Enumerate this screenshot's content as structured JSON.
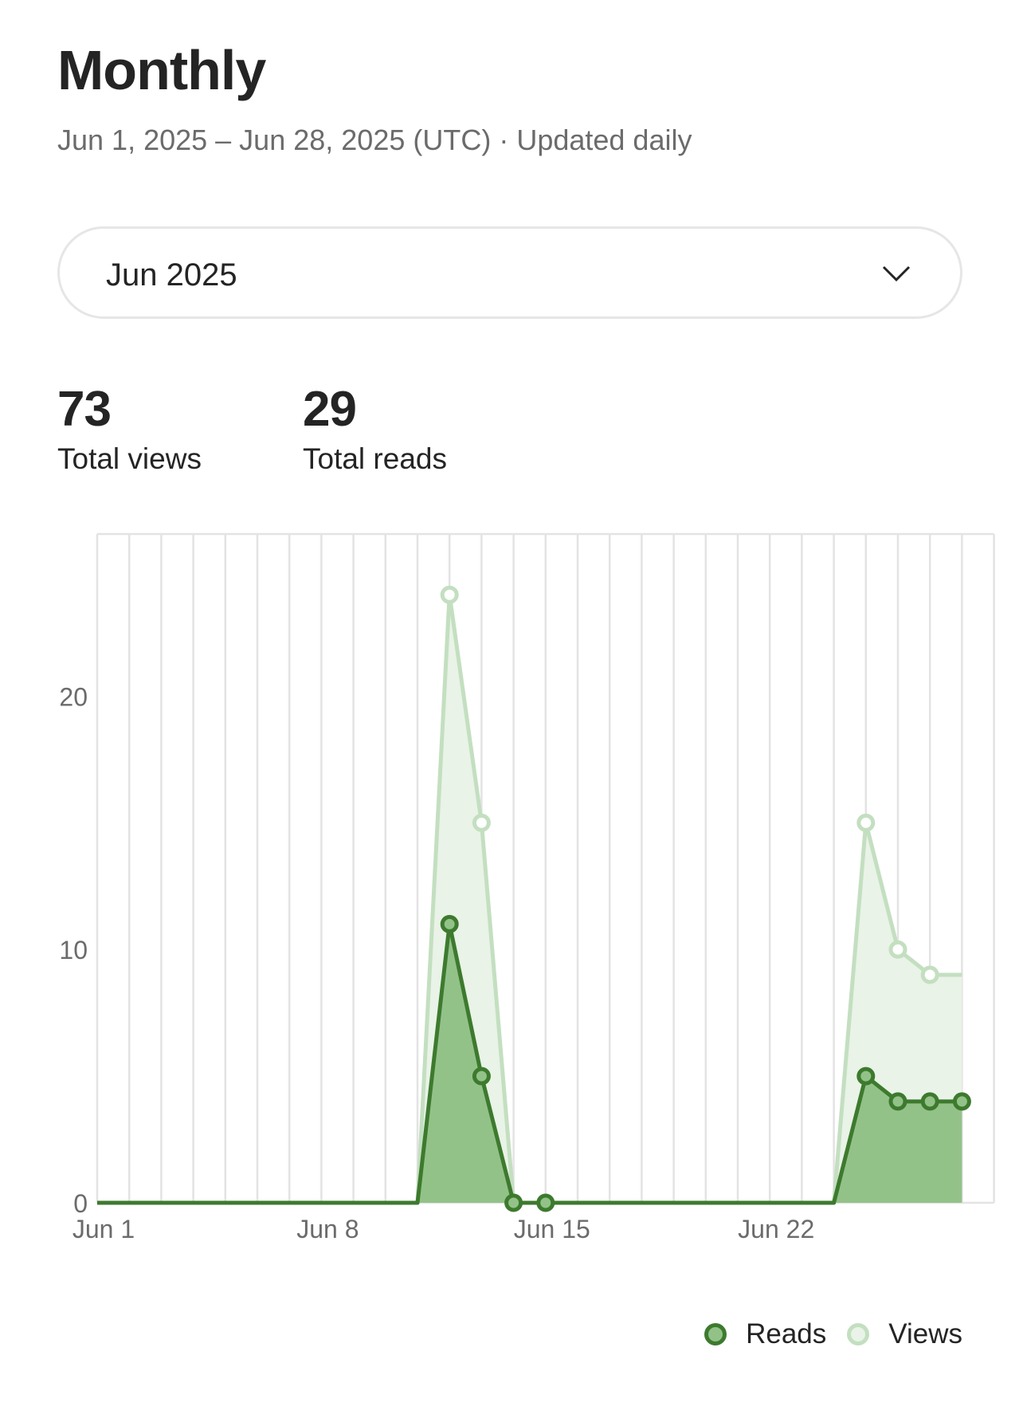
{
  "header": {
    "title": "Monthly",
    "subtitle": "Jun 1, 2025 – Jun 28, 2025 (UTC) · Updated daily"
  },
  "month_select": {
    "value": "Jun 2025",
    "icon": "chevron-down-icon"
  },
  "stats": {
    "views": {
      "value": "73",
      "label": "Total views"
    },
    "reads": {
      "value": "29",
      "label": "Total reads"
    }
  },
  "colors": {
    "reads_line": "#3d7a2e",
    "reads_fill": "#93c289",
    "views_line": "#c3dfc0",
    "views_fill": "#e9f3e7",
    "grid": "#e3e3e3",
    "tick_text": "#6b6b6b"
  },
  "chart_data": {
    "type": "area",
    "x": [
      "Jun 1",
      "Jun 2",
      "Jun 3",
      "Jun 4",
      "Jun 5",
      "Jun 6",
      "Jun 7",
      "Jun 8",
      "Jun 9",
      "Jun 10",
      "Jun 11",
      "Jun 12",
      "Jun 13",
      "Jun 14",
      "Jun 15",
      "Jun 16",
      "Jun 17",
      "Jun 18",
      "Jun 19",
      "Jun 20",
      "Jun 21",
      "Jun 22",
      "Jun 23",
      "Jun 24",
      "Jun 25",
      "Jun 26",
      "Jun 27",
      "Jun 28"
    ],
    "x_ticks": [
      "Jun 1",
      "Jun 8",
      "Jun 15",
      "Jun 22"
    ],
    "y_ticks": [
      0,
      10,
      20
    ],
    "ylim": [
      0,
      26
    ],
    "grid": "vertical",
    "legend": "bottom-right",
    "series": [
      {
        "name": "Reads",
        "values": [
          0,
          0,
          0,
          0,
          0,
          0,
          0,
          0,
          0,
          0,
          0,
          11,
          5,
          0,
          0,
          0,
          0,
          0,
          0,
          0,
          0,
          0,
          0,
          0,
          5,
          4,
          4,
          4
        ],
        "markers": [
          11,
          12,
          13,
          14,
          24,
          25,
          26,
          27
        ]
      },
      {
        "name": "Views",
        "values": [
          0,
          0,
          0,
          0,
          0,
          0,
          0,
          0,
          0,
          0,
          0,
          24,
          15,
          0,
          0,
          0,
          0,
          0,
          0,
          0,
          0,
          0,
          0,
          0,
          15,
          10,
          9,
          9
        ],
        "markers": [
          11,
          12,
          24,
          25,
          26
        ]
      }
    ]
  }
}
